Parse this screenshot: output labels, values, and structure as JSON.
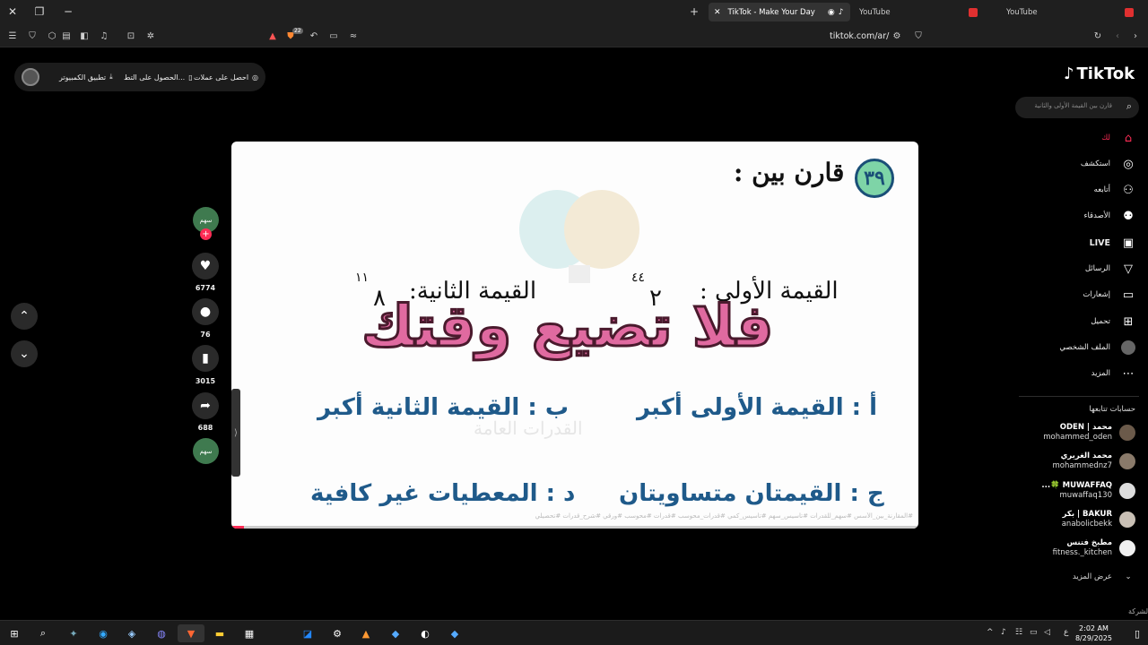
{
  "browser": {
    "tabs": [
      {
        "label": "TikTok - Make Your Day",
        "active": true
      },
      {
        "label": "YouTube",
        "active": false
      },
      {
        "label": "YouTube",
        "active": false
      }
    ],
    "new_tab": "+",
    "url": "tiktok.com/ar/",
    "shield_count": "22"
  },
  "topbar": {
    "get_coins": "احصل على عملات",
    "get_app": "الحصول على التط...",
    "desktop_app": "تطبيق الكمبيوتر"
  },
  "video": {
    "question_number": "٣٩",
    "title": "قارن بين :",
    "value1_label": "القيمة الأولى :",
    "value1_base": "٢",
    "value1_exp": "٤٤",
    "value2_label": "القيمة الثانية:",
    "value2_base": "٨",
    "value2_exp": "١١",
    "overlay": "فلا تضيع وقتك",
    "option_a": "أ : القيمة الأولى أكبر",
    "option_b": "ب : القيمة الثانية أكبر",
    "option_c": "ج : القيمتان متساويتان",
    "option_d": "د : المعطيات غير كافية",
    "watermark_text": "القدرات العامة",
    "hashtags": "#المقارنة_بين_الأسس #سهم_للقدرات #تأسيس_سهم #تأسيس_كمي #قدرات_محوسب #قدرات #محوسب #ورقي #شرح_قدرات #تحصيلي",
    "progress_fraction": 0.02
  },
  "actions": {
    "creator_avatar": "سهم",
    "likes": "6774",
    "comments": "76",
    "saves": "3015",
    "shares": "688"
  },
  "sidebar": {
    "logo": "TikTok",
    "search_placeholder": "قارن بين القيمة الأولى والثانية",
    "nav": [
      {
        "label": "لك",
        "icon": "home-icon",
        "active": true
      },
      {
        "label": "استكشف",
        "icon": "compass-icon"
      },
      {
        "label": "أتابعه",
        "icon": "following-icon"
      },
      {
        "label": "الأصدقاء",
        "icon": "friends-icon"
      },
      {
        "label": "LIVE",
        "icon": "live-icon"
      },
      {
        "label": "الرسائل",
        "icon": "messages-icon"
      },
      {
        "label": "إشعارات",
        "icon": "notifications-icon"
      },
      {
        "label": "تحميل",
        "icon": "upload-icon"
      },
      {
        "label": "الملف الشخصي",
        "icon": "profile-icon"
      },
      {
        "label": "المزيد",
        "icon": "more-icon"
      }
    ],
    "following_header": "حسابات تتابعها",
    "following": [
      {
        "name": "محمد | ODEN",
        "user": "mohammed_oden"
      },
      {
        "name": "محمد الغريري",
        "user": "mohammednz7"
      },
      {
        "name": "MUWAFFAQ 🍀...",
        "user": "muwaffaq130"
      },
      {
        "name": "BAKUR | بكر",
        "user": "anabolicbekk"
      },
      {
        "name": "مطبخ فتنس",
        "user": "fitness._kitchen"
      }
    ],
    "see_more": "عرض المزيد",
    "company": "الشركة"
  },
  "taskbar": {
    "time": "2:02 AM",
    "date": "8/29/2025",
    "lang": "ع"
  },
  "colors": {
    "accent": "#fe2c55",
    "question_blue": "#1f5a8a",
    "overlay_pink": "#e06aa0"
  }
}
